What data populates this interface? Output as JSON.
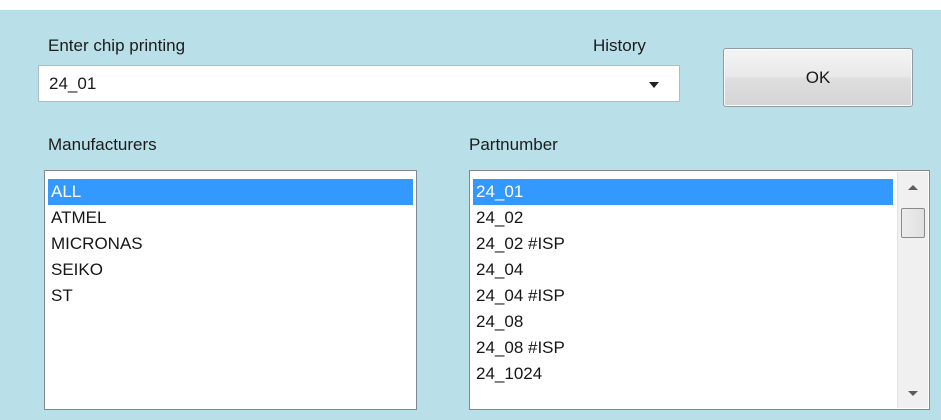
{
  "dialog": {
    "chip_label": "Enter chip printing",
    "history_label": "History",
    "chip_input": {
      "value": "24_01"
    },
    "ok_label": "OK",
    "manufacturers_label": "Manufacturers",
    "partnumber_label": "Partnumber"
  },
  "manufacturers": {
    "selected_index": 0,
    "items": [
      "ALL",
      "ATMEL",
      "MICRONAS",
      "SEIKO",
      "ST"
    ]
  },
  "partnumbers": {
    "selected_index": 0,
    "items": [
      "24_01",
      "24_02",
      "24_02 #ISP",
      "24_04",
      "24_04 #ISP",
      "24_08",
      "24_08 #ISP",
      "24_1024"
    ]
  },
  "colors": {
    "dialog_background": "#b9dfe9",
    "selection": "#3399ff"
  },
  "icons": {
    "combo_dropdown": "chevron-down-icon",
    "scroll_up": "scroll-up-icon",
    "scroll_down": "scroll-down-icon"
  }
}
